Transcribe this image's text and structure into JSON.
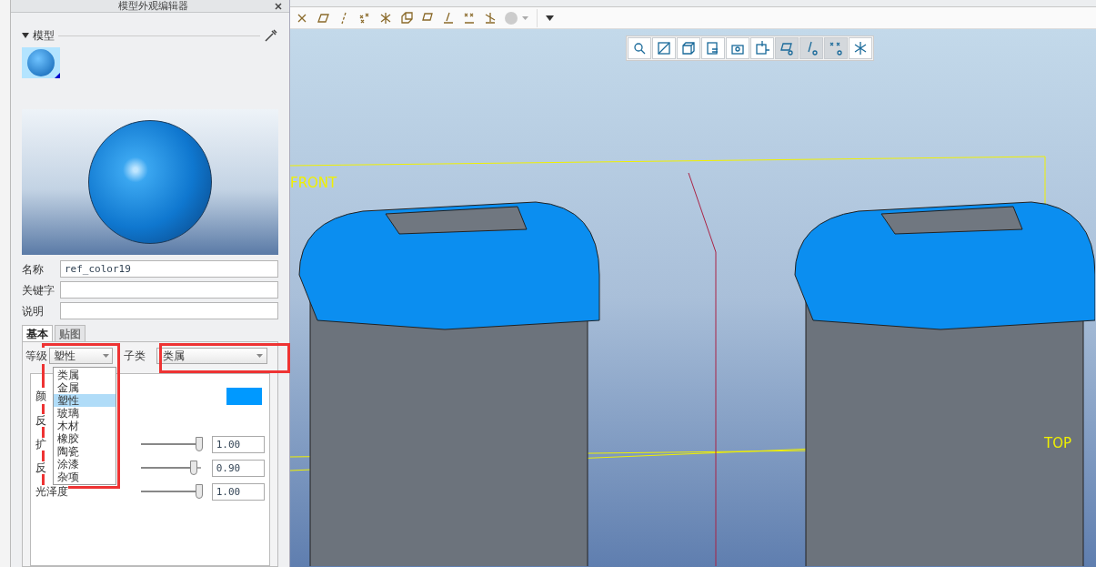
{
  "panel": {
    "title": "模型外观编辑器",
    "section": "模型",
    "fields": [
      {
        "label": "名称",
        "value": "ref_color19"
      },
      {
        "label": "关键字"
      },
      {
        "label": "说明"
      }
    ],
    "tabs": [
      {
        "label": "基本",
        "selected": true
      },
      {
        "label": "贴图",
        "selected": false
      }
    ],
    "class_label": "等级",
    "class_value": "塑性",
    "subclass_label": "子类",
    "subclass_value": "类属",
    "class_options": [
      {
        "label": "类属",
        "selected": false
      },
      {
        "label": "金属",
        "selected": false
      },
      {
        "label": "塑性",
        "selected": true
      },
      {
        "label": "玻璃",
        "selected": false
      },
      {
        "label": "木材",
        "selected": false
      },
      {
        "label": "橡胶",
        "selected": false
      },
      {
        "label": "陶瓷",
        "selected": false
      },
      {
        "label": "涂漆",
        "selected": false
      },
      {
        "label": "杂项",
        "selected": false
      }
    ],
    "color_label": "颜",
    "color": "#0099ff",
    "props": [
      {
        "label": "反",
        "kind": "label"
      },
      {
        "label": "扩",
        "kind": "slider",
        "level": 1.0,
        "reading": "1.00"
      },
      {
        "label": "反",
        "kind": "slider",
        "level": 0.9,
        "reading": "0.90"
      },
      {
        "label": "光泽度",
        "kind": "slider",
        "level": 1.0,
        "reading": "1.00"
      }
    ]
  },
  "viewport": {
    "labels": [
      {
        "text": "FRONT"
      },
      {
        "text": "TOP"
      }
    ]
  }
}
